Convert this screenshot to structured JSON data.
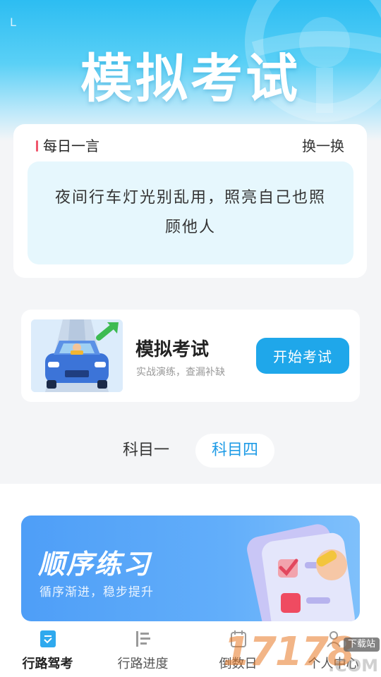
{
  "status_bar": {
    "left_glyph": "L"
  },
  "header": {
    "title": "模拟考试",
    "decor_icon": "steering-wheel-icon"
  },
  "daily_quote": {
    "label": "每日一言",
    "refresh_label": "换一换",
    "text": "夜间行车灯光别乱用，照亮自己也照顾他人"
  },
  "exam_card": {
    "thumb_icon": "car-illustration",
    "title": "模拟考试",
    "subtitle": "实战演练，查漏补缺",
    "button_label": "开始考试"
  },
  "subject_tabs": {
    "items": [
      "科目一",
      "科目四"
    ],
    "selected": "科目四"
  },
  "practice_card": {
    "title": "顺序练习",
    "subtitle": "循序渐进，稳步提升",
    "art_icon": "checklist-illustration"
  },
  "bottom_nav": {
    "items": [
      {
        "label": "行路驾考",
        "icon": "exam-icon",
        "active": true
      },
      {
        "label": "行路进度",
        "icon": "progress-icon",
        "active": false
      },
      {
        "label": "倒数日",
        "icon": "countdown-icon",
        "active": false
      },
      {
        "label": "个人中心",
        "icon": "user-icon",
        "active": false
      }
    ]
  },
  "watermark": {
    "digits": "17178",
    "domain": ".COM",
    "tag": "下载站"
  },
  "colors": {
    "accent": "#1fa7ea",
    "tab_selected_text": "#1e9be6",
    "quote_marker": "#f0566c",
    "quote_bg": "#e6f7fd",
    "practice_card": "#4e9ef7"
  }
}
